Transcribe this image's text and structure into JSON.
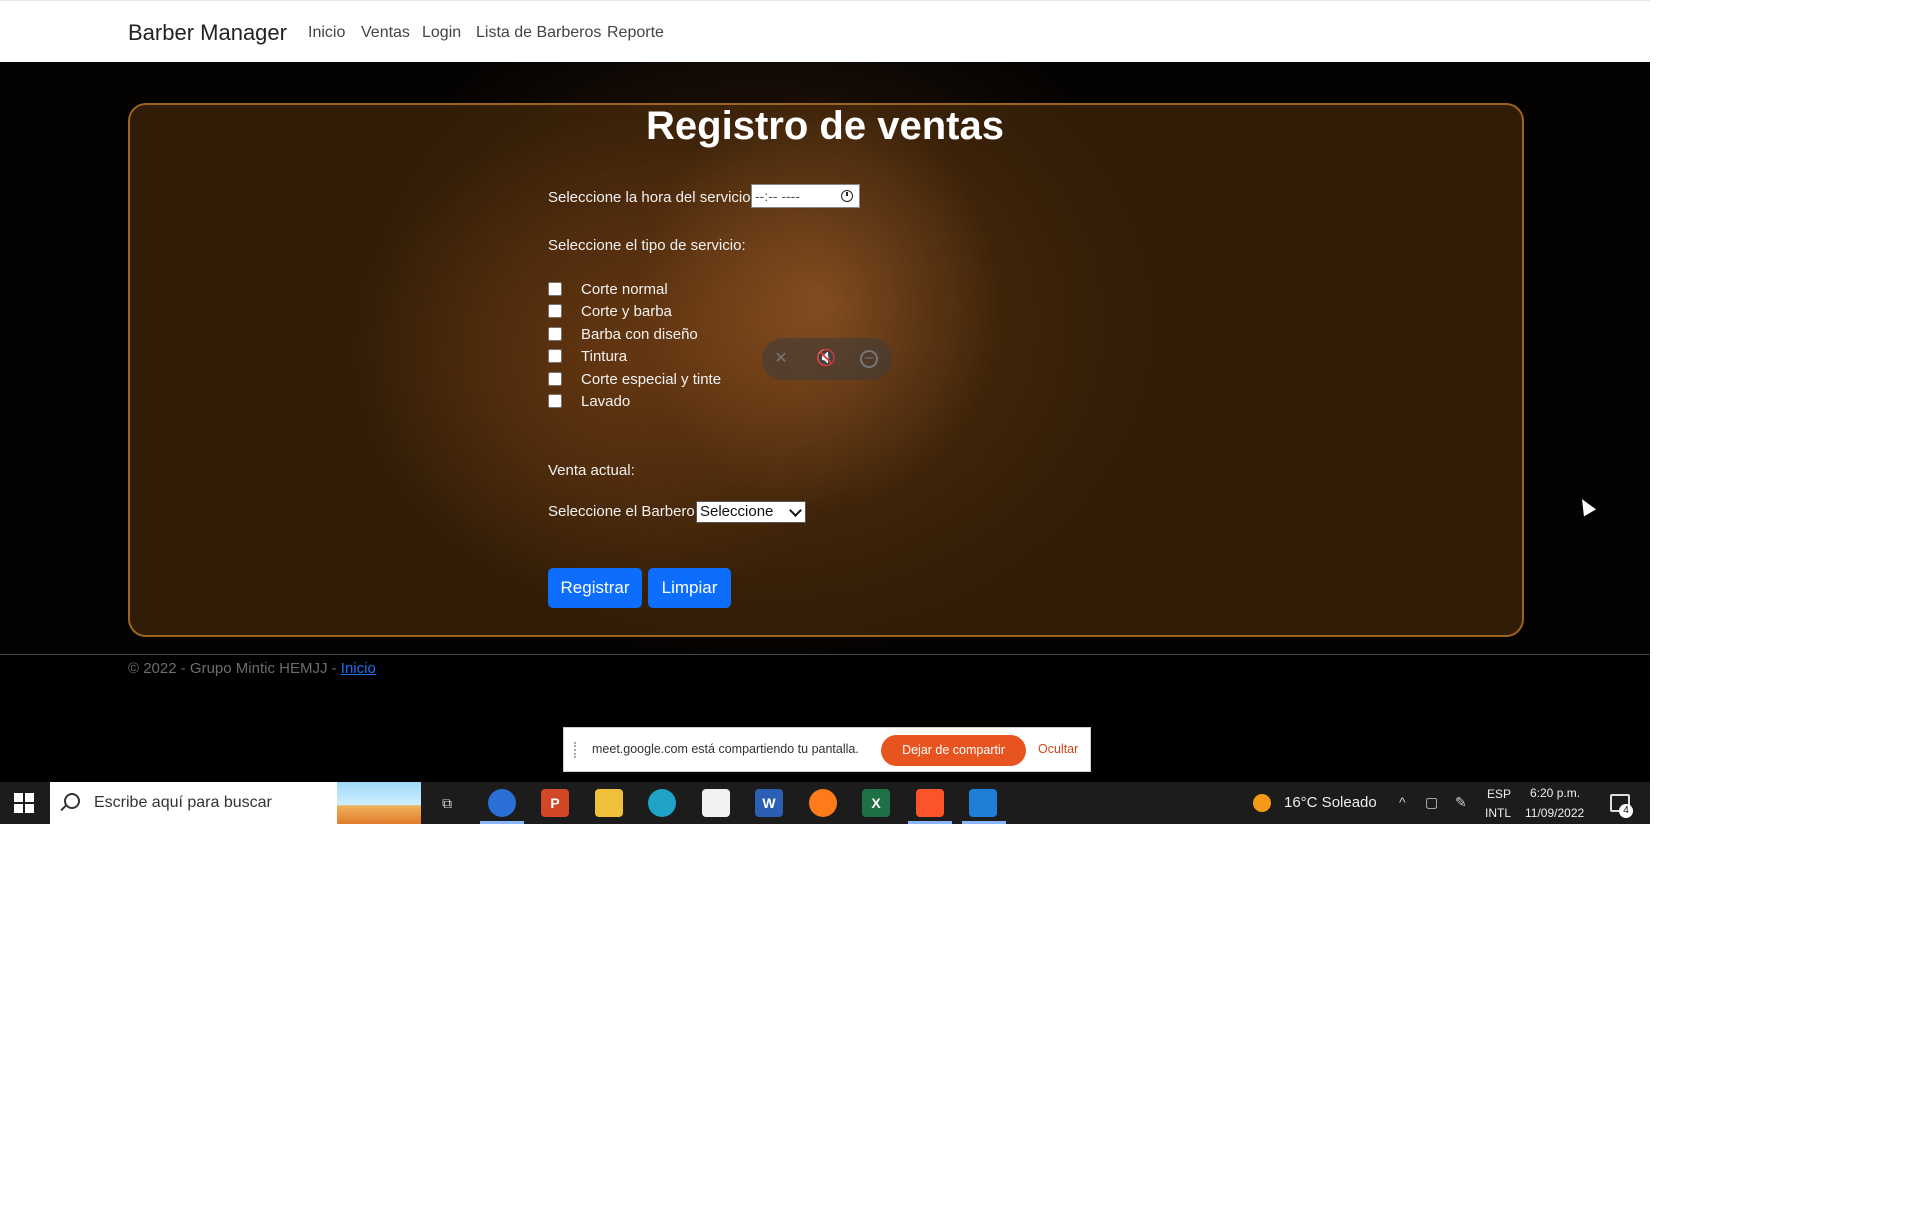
{
  "navbar": {
    "brand": "Barber Manager",
    "links": [
      "Inicio",
      "Ventas",
      "Login",
      "Lista de Barberos",
      "Reporte"
    ]
  },
  "form": {
    "title": "Registro de ventas",
    "time_label": "Seleccione la hora del servicio",
    "time_value": "--:-- ----",
    "service_label": "Seleccione el tipo de servicio:",
    "services": [
      "Corte normal",
      "Corte y barba",
      "Barba con diseño",
      "Tintura",
      "Corte especial y tinte",
      "Lavado"
    ],
    "current_sale_label": "Venta actual:",
    "barber_label": "Seleccione el Barbero",
    "barber_selected": "Seleccione",
    "register_button": "Registrar",
    "clear_button": "Limpiar"
  },
  "footer": {
    "text": "© 2022 - Grupo Mintic HEMJJ - ",
    "link": "Inicio"
  },
  "share_bar": {
    "message": "meet.google.com está compartiendo tu pantalla.",
    "stop_button": "Dejar de compartir",
    "hide_button": "Ocultar"
  },
  "taskbar": {
    "search_placeholder": "Escribe aquí para buscar",
    "weather": "16°C  Soleado",
    "lang_line1": "ESP",
    "lang_line2": "INTL",
    "time": "6:20 p.m.",
    "date": "11/09/2022",
    "notification_count": "4",
    "apps": [
      "task-view",
      "firefox-dev",
      "powerpoint",
      "file-explorer",
      "edge",
      "microsoft-store",
      "word",
      "firefox",
      "excel",
      "brave",
      "vscode"
    ]
  },
  "colors": {
    "primary_button": "#0d6efd",
    "stop_share": "#e8541f",
    "card_border": "#9b6420"
  }
}
